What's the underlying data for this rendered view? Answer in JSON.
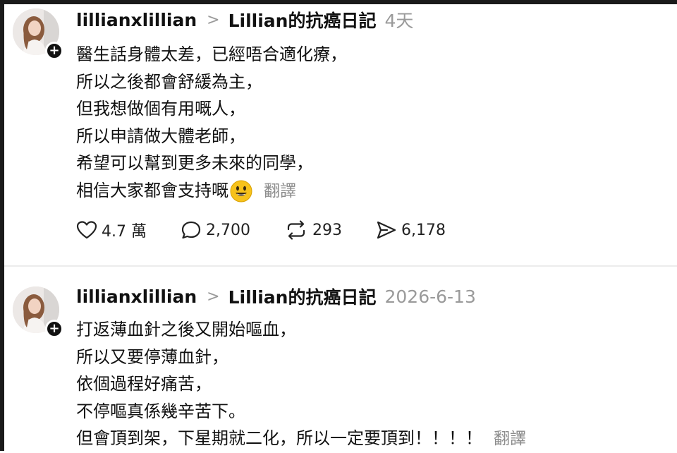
{
  "posts": [
    {
      "username": "lillianxlillian",
      "separator": ">",
      "topic": "Lillian的抗癌日記",
      "time": "4天",
      "lines": [
        "醫生話身體太差，已經唔合適化療，",
        "所以之後都會舒緩為主，",
        "但我想做個有用嘅人，",
        "所以申請做大體老師，",
        "希望可以幫到更多未來的同學，",
        "相信大家都會支持嘅"
      ],
      "translate": "翻譯",
      "emoji": "smiley-emoji",
      "actions": {
        "likes": "4.7 萬",
        "comments": "2,700",
        "reposts": "293",
        "shares": "6,178"
      }
    },
    {
      "username": "lillianxlillian",
      "separator": ">",
      "topic": "Lillian的抗癌日記",
      "time": "2026-6-13",
      "lines": [
        "打返薄血針之後又開始嘔血，",
        "所以又要停薄血針，",
        "依個過程好痛苦，",
        "不停嘔真係幾辛苦下。",
        "但會頂到架，下星期就二化，所以一定要頂到！！！！"
      ],
      "translate": "翻譯"
    }
  ],
  "colors": {
    "text": "#111111",
    "muted": "#9a9a9a",
    "emoji": "#f7c21b"
  }
}
